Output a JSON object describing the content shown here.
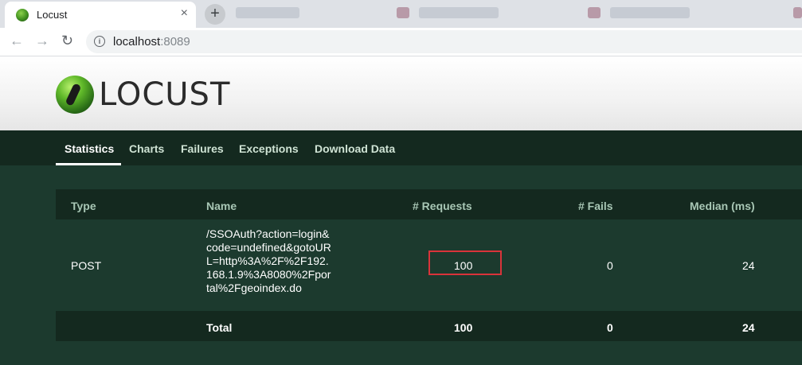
{
  "browser": {
    "tab_title": "Locust",
    "tab_close": "×",
    "new_tab": "+",
    "url_host": "localhost",
    "url_port": ":8089"
  },
  "app": {
    "logo_text": "LOCUST"
  },
  "nav": {
    "tabs": [
      "Statistics",
      "Charts",
      "Failures",
      "Exceptions",
      "Download Data"
    ],
    "active": "Statistics"
  },
  "table": {
    "headers": {
      "type": "Type",
      "name": "Name",
      "requests": "# Requests",
      "fails": "# Fails",
      "median": "Median (ms)"
    },
    "rows": [
      {
        "type": "POST",
        "name": "/SSOAuth?action=login&code=undefined&gotoURL=http%3A%2F%2F192.168.1.9%3A8080%2Fportal%2Fgeoindex.do",
        "requests": "100",
        "fails": "0",
        "median": "24"
      }
    ],
    "total": {
      "label": "Total",
      "requests": "100",
      "fails": "0",
      "median": "24"
    }
  },
  "colors": {
    "page_bg": "#1c3a2e",
    "nav_bg": "#14291f",
    "header_text": "#a8c7b5",
    "highlight_border": "#d9333a"
  }
}
